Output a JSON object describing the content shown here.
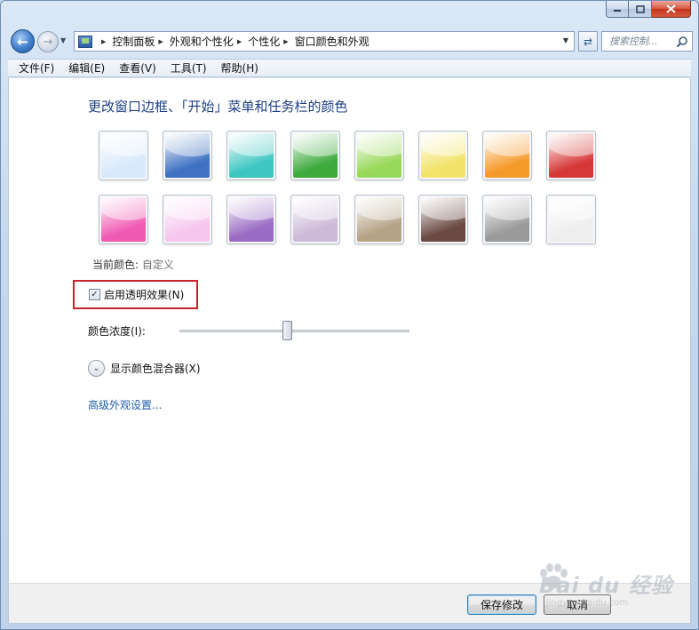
{
  "window": {
    "caption": {
      "minimize_icon": "minimize-icon",
      "maximize_icon": "maximize-icon",
      "close_icon": "close-icon"
    }
  },
  "nav": {
    "back_icon": "back-arrow-icon",
    "forward_icon": "forward-arrow-icon",
    "breadcrumbs": [
      "控制面板",
      "外观和个性化",
      "个性化",
      "窗口颜色和外观"
    ],
    "search_placeholder": "搜索控制..."
  },
  "menu": [
    "文件(F)",
    "编辑(E)",
    "查看(V)",
    "工具(T)",
    "帮助(H)"
  ],
  "content": {
    "heading": "更改窗口边框、「开始」菜单和任务栏的颜色",
    "swatches_row1": [
      {
        "name": "sky",
        "color": "#d8e9fb"
      },
      {
        "name": "twilight",
        "color": "#3f72c2"
      },
      {
        "name": "sea",
        "color": "#3ec6c2"
      },
      {
        "name": "leaf",
        "color": "#3eaa3e"
      },
      {
        "name": "lime",
        "color": "#98d85a"
      },
      {
        "name": "sun",
        "color": "#f2e36a"
      },
      {
        "name": "pumpkin",
        "color": "#f59a2a"
      },
      {
        "name": "ruby",
        "color": "#d63838"
      }
    ],
    "swatches_row2": [
      {
        "name": "fuchsia",
        "color": "#f05ab4"
      },
      {
        "name": "blush",
        "color": "#f6c6ee"
      },
      {
        "name": "violet",
        "color": "#9a6cc4"
      },
      {
        "name": "lavender",
        "color": "#cdb9d8"
      },
      {
        "name": "taupe",
        "color": "#b5a386"
      },
      {
        "name": "chocolate",
        "color": "#6b4a44"
      },
      {
        "name": "slate",
        "color": "#9a9a9a"
      },
      {
        "name": "frost",
        "color": "#eeeeee"
      }
    ],
    "current_color_label": "当前颜色:",
    "current_color_value": "自定义",
    "transparency_label": "启用透明效果(N)",
    "transparency_checked": true,
    "intensity_label": "颜色浓度(I):",
    "intensity_value_fraction": 0.47,
    "mixer_label": "显示颜色混合器(X)",
    "advanced_link": "高级外观设置..."
  },
  "footer": {
    "save_label": "保存修改",
    "cancel_label": "取消"
  },
  "watermark": {
    "text": "Bai du 经验",
    "sub": "jingyan.baidu.com"
  }
}
